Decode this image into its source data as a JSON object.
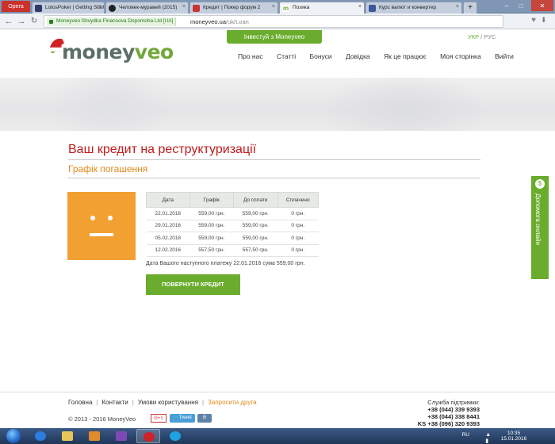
{
  "browser": {
    "menu_label": "Opera",
    "tabs": [
      {
        "label": "LotosPoker | Getting Start",
        "active": false
      },
      {
        "label": "Человек-муравей (2015)",
        "active": false
      },
      {
        "label": "Кредит | Покер форум 2",
        "active": false
      },
      {
        "label": "Позика",
        "active": true
      },
      {
        "label": "Курс валют и конвертер",
        "active": false
      }
    ],
    "secure_label": "Moneyveo Shvydka Finansova Dopomoha Ltd [UA]",
    "url_host": "moneyveo.ua",
    "url_path": "/uk/Loan"
  },
  "header": {
    "logo_money": "money",
    "logo_veo": "veo",
    "invest_button": "Інвестуй з Moneyveo",
    "lang_active": "УКР",
    "lang_sep": "/",
    "lang_other": "РУС",
    "nav": [
      "Про нас",
      "Статті",
      "Бонуси",
      "Довідка",
      "Як це працює",
      "Моя сторінка",
      "Вийти"
    ]
  },
  "main": {
    "title": "Ваш кредит на реструктуризації",
    "subtitle": "Графік погашення",
    "table": {
      "columns": [
        "Дата",
        "Графік",
        "До сплати",
        "Сплачено"
      ],
      "rows": [
        [
          "22.01.2016",
          "559,00 грн.",
          "559,00 грн.",
          "0 грн."
        ],
        [
          "29.01.2016",
          "559,00 грн.",
          "559,00 грн.",
          "0 грн."
        ],
        [
          "05.02.2016",
          "559,00 грн.",
          "559,00 грн.",
          "0 грн."
        ],
        [
          "12.02.2016",
          "557,50 грн.",
          "557,50 грн.",
          "0 грн."
        ]
      ]
    },
    "next_payment": "Дата Вашого наступного платежу 22.01.2016 сума 559,00 грн.",
    "pay_button": "ПОВЕРНУТИ КРЕДИТ",
    "help_tab": "Допомога онлайн",
    "help_badge": "$"
  },
  "footer": {
    "links": [
      "Головна",
      "Контакти",
      "Умови користування"
    ],
    "invite_link": "Запросити друга",
    "copyright": "© 2013 - 2016 MoneyVeo",
    "gplus": "G+1",
    "tweet": "Tweet",
    "vk": "В",
    "support_label": "Служба підтримки:",
    "phones": [
      "+38 (044) 339 9393",
      "+38 (044) 338 8441",
      "+38 (096) 320 9393"
    ],
    "phone_prefix": "KS"
  },
  "taskbar": {
    "lang": "RU",
    "time": "10:35",
    "date": "15.01.2016"
  },
  "colors": {
    "brand_green": "#6aac2d",
    "title_red": "#c01b1b",
    "subtitle_orange": "#e08a1a",
    "face_orange": "#f2a032"
  }
}
